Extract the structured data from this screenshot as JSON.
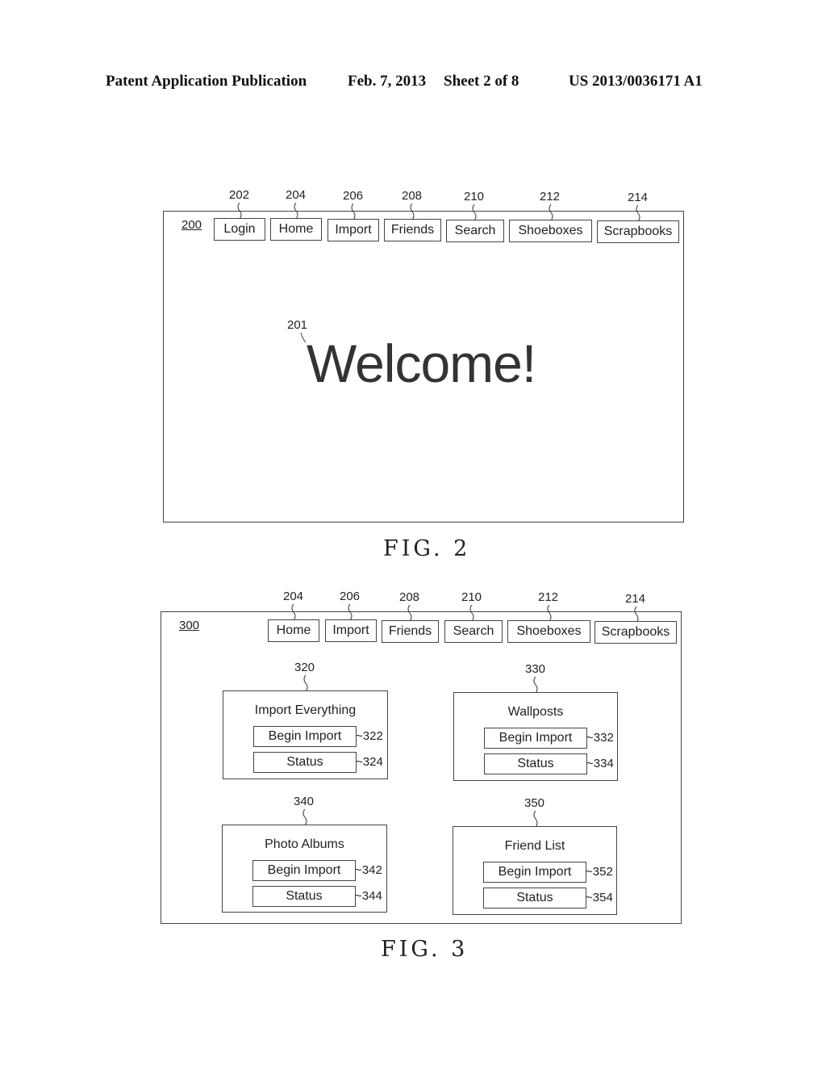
{
  "header": {
    "publication": "Patent Application Publication",
    "date": "Feb. 7, 2013",
    "sheet": "Sheet 2 of 8",
    "number": "US 2013/0036171 A1"
  },
  "fig2": {
    "ref": "200",
    "caption": "FIG. 2",
    "nav": [
      {
        "label": "Login",
        "ref": "202"
      },
      {
        "label": "Home",
        "ref": "204"
      },
      {
        "label": "Import",
        "ref": "206"
      },
      {
        "label": "Friends",
        "ref": "208"
      },
      {
        "label": "Search",
        "ref": "210"
      },
      {
        "label": "Shoeboxes",
        "ref": "212"
      },
      {
        "label": "Scrapbooks",
        "ref": "214"
      }
    ],
    "welcome": {
      "text": "Welcome!",
      "ref": "201"
    }
  },
  "fig3": {
    "ref": "300",
    "caption": "FIG. 3",
    "nav": [
      {
        "label": "Home",
        "ref": "204"
      },
      {
        "label": "Import",
        "ref": "206"
      },
      {
        "label": "Friends",
        "ref": "208"
      },
      {
        "label": "Search",
        "ref": "210"
      },
      {
        "label": "Shoeboxes",
        "ref": "212"
      },
      {
        "label": "Scrapbooks",
        "ref": "214"
      }
    ],
    "cards": [
      {
        "title": "Import Everything",
        "ref": "320",
        "begin_label": "Begin Import",
        "begin_ref": "~322",
        "status_label": "Status",
        "status_ref": "~324"
      },
      {
        "title": "Wallposts",
        "ref": "330",
        "begin_label": "Begin Import",
        "begin_ref": "~332",
        "status_label": "Status",
        "status_ref": "~334"
      },
      {
        "title": "Photo Albums",
        "ref": "340",
        "begin_label": "Begin Import",
        "begin_ref": "~342",
        "status_label": "Status",
        "status_ref": "~344"
      },
      {
        "title": "Friend List",
        "ref": "350",
        "begin_label": "Begin Import",
        "begin_ref": "~352",
        "status_label": "Status",
        "status_ref": "~354"
      }
    ]
  }
}
